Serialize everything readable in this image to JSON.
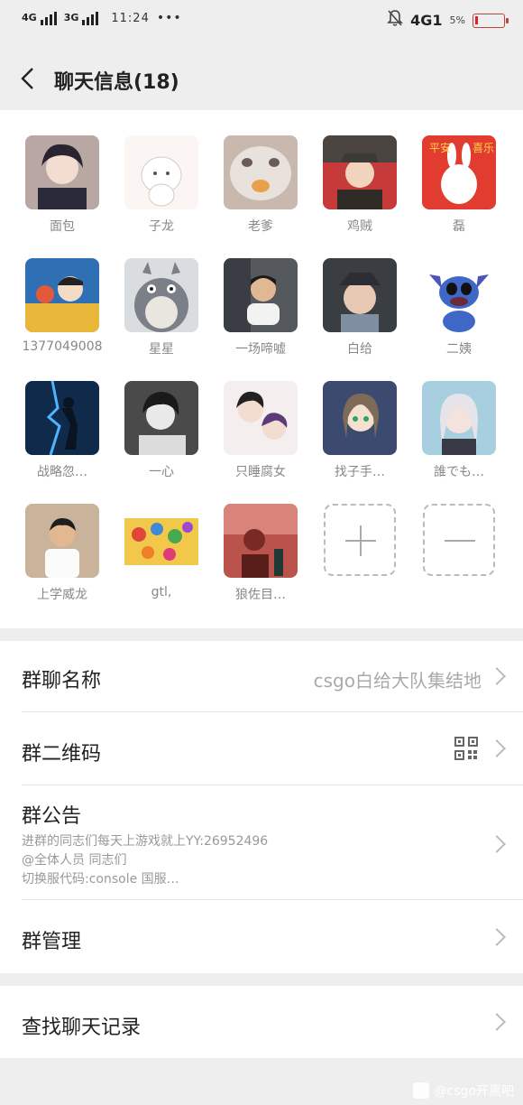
{
  "status_bar": {
    "net1": "4G",
    "net2": "3G",
    "time": "11:24",
    "net3": "4G1",
    "battery": "5%"
  },
  "header": {
    "title": "聊天信息(18)"
  },
  "members": [
    {
      "name": "面包",
      "avatar": "anime-boy-avatar"
    },
    {
      "name": "子龙",
      "avatar": "cartoon-cat-avatar"
    },
    {
      "name": "老爹",
      "avatar": "cat-photo-avatar"
    },
    {
      "name": "鸡贼",
      "avatar": "anime-soldier-avatar"
    },
    {
      "name": "磊",
      "avatar": "new-year-rabbit-avatar"
    },
    {
      "name": "1377049008",
      "avatar": "detective-anime-avatar"
    },
    {
      "name": "星星",
      "avatar": "totoro-avatar"
    },
    {
      "name": "一场啼嘘",
      "avatar": "child-photo-avatar"
    },
    {
      "name": "白给",
      "avatar": "baby-photo-avatar"
    },
    {
      "name": "二姨",
      "avatar": "stitch-avatar"
    },
    {
      "name": "战略忽…",
      "avatar": "dark-warrior-avatar"
    },
    {
      "name": "一心",
      "avatar": "mono-anime-avatar"
    },
    {
      "name": "只睡腐女",
      "avatar": "anime-duo-avatar"
    },
    {
      "name": "找子手…",
      "avatar": "anime-girl-green-avatar"
    },
    {
      "name": "誰でも…",
      "avatar": "silver-hair-anime-avatar"
    },
    {
      "name": "上学威龙",
      "avatar": "kid-photo-avatar"
    },
    {
      "name": "gtl,",
      "avatar": "colorful-collage-avatar"
    },
    {
      "name": "狼佐目…",
      "avatar": "red-tone-photo-avatar"
    }
  ],
  "actions": {
    "add": "add-member",
    "remove": "remove-member"
  },
  "settings": {
    "group_name_label": "群聊名称",
    "group_name_value": "csgo白给大队集结地",
    "qr_label": "群二维码",
    "announce_label": "群公告",
    "announce_line1": "进群的同志们每天上游戏就上YY:26952496",
    "announce_line2": "@全体人员 同志们",
    "announce_line3": "切换服代码:console 国服…",
    "manage_label": "群管理",
    "search_label": "查找聊天记录"
  },
  "watermark": "@csgo开黑吧"
}
